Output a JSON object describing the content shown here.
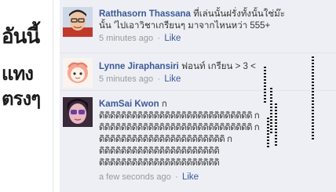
{
  "handwriting": {
    "line1": "อันนี้",
    "line2": "แทง",
    "line3": "ตรงๆ"
  },
  "comments": [
    {
      "author": "Ratthasorn Thassana",
      "text_line1": "ที่เล่นนั้นฝรั่งทั้งนั้นใช่ม๊ะ",
      "text_line2": "นั้น 'ไปเอาวิชาเกรียนๆ มาจากไหนหว่า 555+",
      "time": "5 minutes ago",
      "like": "Like"
    },
    {
      "author": "Lynne Jiraphansiri",
      "text_line1": "ฟอนท์ เกรียน > 3 <",
      "time": "5 minutes ago",
      "like": "Like"
    },
    {
      "author": "KamSai Kwon",
      "text_line1": "ก",
      "text_lines": [
        "ดิดิดิดิดิดิดิดิดิดิดิดิดิดิดิดิดิดิดิดิดิดิดิดิดิดิดิดิ ก",
        "ดิดิดิดิดิดิดิดิดิดิดิดิดิดิดิดิดิดิดิดิดิดิดิดิดิดิดิดิ ก",
        "ดิดิดิดิดิดิดิดิดิดิดิดิดิดิดิดิดิดิดิดิดิดิดิ ก",
        "ดิดิดิดิดิดิดิดิดิดิดิดิดิดิดิดิดิดิดิดิดิดิ",
        "ดิดิดิดิดิดิดิดิดิดิดิดิดิดิดิดิดิดิดิดิดิดิ"
      ],
      "time": "a few seconds ago",
      "like": "Like"
    }
  ],
  "separator": "·"
}
